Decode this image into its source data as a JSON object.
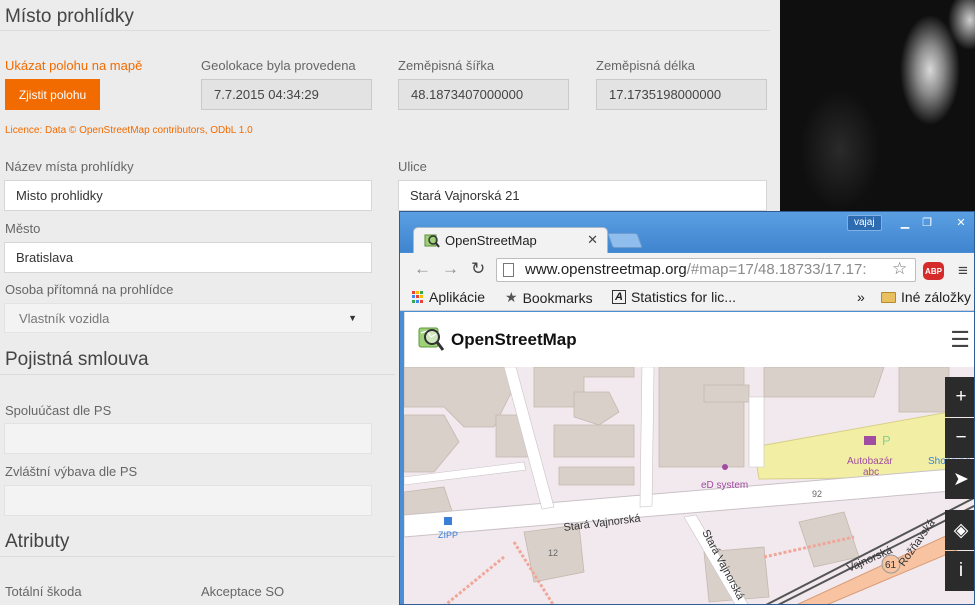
{
  "form": {
    "section_visit": "Místo prohlídky",
    "show_on_map_label": "Ukázat polohu na mapě",
    "locate_button": "Zjistit polohu",
    "geolocation_label": "Geolokace byla provedena",
    "geolocation_value": "7.7.2015 04:34:29",
    "latitude_label": "Zeměpisná šířka",
    "latitude_value": "48.1873407000000",
    "longitude_label": "Zeměpisná délka",
    "longitude_value": "17.1735198000000",
    "license": "Licence: Data © OpenStreetMap contributors, ODbL 1.0",
    "place_name_label": "Název místa prohlídky",
    "place_name_value": "Misto prohlidky",
    "street_label": "Ulice",
    "street_value": "Stará Vajnorská 21",
    "city_label": "Město",
    "city_value": "Bratislava",
    "person_label": "Osoba přítomná na prohlídce",
    "person_value": "Vlastník vozidla",
    "section_policy": "Pojistná smlouva",
    "coinsurance_label": "Spoluúčast dle PS",
    "special_equipment_label": "Zvláštní výbava dle PS",
    "section_attributes": "Atributy",
    "total_loss_label": "Totální škoda",
    "acceptance_label": "Akceptace SO"
  },
  "browser": {
    "profile_name": "vajaj",
    "tab_title": "OpenStreetMap",
    "url_main": "www.openstreetmap.org",
    "url_rest": "/#map=17/48.18733/17.17:",
    "bookmarks": [
      "Aplikácie",
      "Bookmarks",
      "Statistics for lic..."
    ],
    "overflow": "»",
    "other_bookmarks": "Iné záložky",
    "abp_label": "ABP"
  },
  "osm": {
    "brand": "OpenStreetMap",
    "labels": {
      "street1": "Stará Vajnorská",
      "street2": "Stará Vajnorská",
      "street3": "Vajnorská",
      "street4": "Rožňavská",
      "poi_system": "eD system",
      "poi_autobazar": "Autobazár",
      "poi_autobazar2": "abc",
      "poi_shopping": "Shopping",
      "bus": "ZIPP",
      "house1": "92",
      "house2": "12",
      "route": "61",
      "parking": "P"
    }
  },
  "colors": {
    "orange": "#f26b00",
    "window_blue": "#4a8fd6",
    "map_bg": "#f2e9ee",
    "building": "#d9d0c9",
    "commercial": "#f2efa4"
  }
}
